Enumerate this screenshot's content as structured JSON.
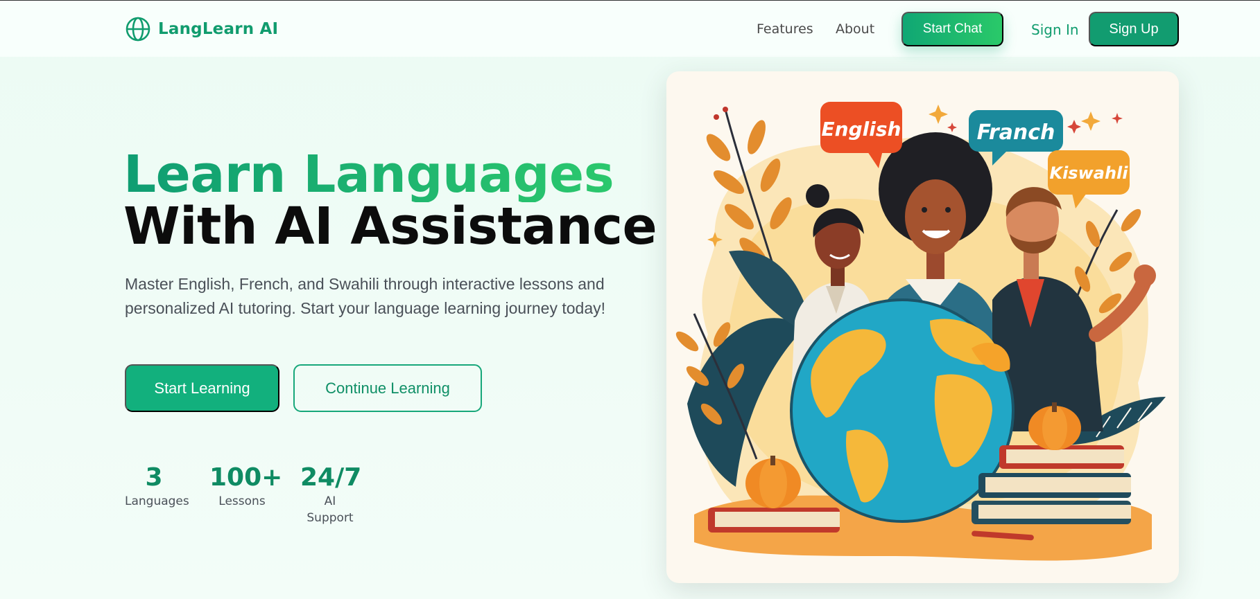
{
  "brand": {
    "name": "LangLearn AI",
    "icon": "globe-icon"
  },
  "nav": {
    "features_label": "Features",
    "about_label": "About",
    "start_chat_label": "Start Chat",
    "sign_in_label": "Sign In",
    "sign_up_label": "Sign Up"
  },
  "hero": {
    "title_line1": "Learn Languages",
    "title_line2": "With AI Assistance",
    "description": "Master English, French, and Swahili through interactive lessons and personalized AI tutoring. Start your language learning journey today!",
    "start_learning_label": "Start Learning",
    "continue_learning_label": "Continue Learning"
  },
  "stats": [
    {
      "value": "3",
      "label": "Languages"
    },
    {
      "value": "100+",
      "label": "Lessons"
    },
    {
      "value": "24/7",
      "label": "AI Support"
    }
  ],
  "illustration": {
    "bubble_1": "English",
    "bubble_2": "Franch",
    "bubble_3": "Kiswahli"
  },
  "colors": {
    "brand_green": "#119c6e",
    "accent_gradient_start": "#10a774",
    "accent_gradient_end": "#2ac969",
    "page_background": "#ecfbf4"
  }
}
